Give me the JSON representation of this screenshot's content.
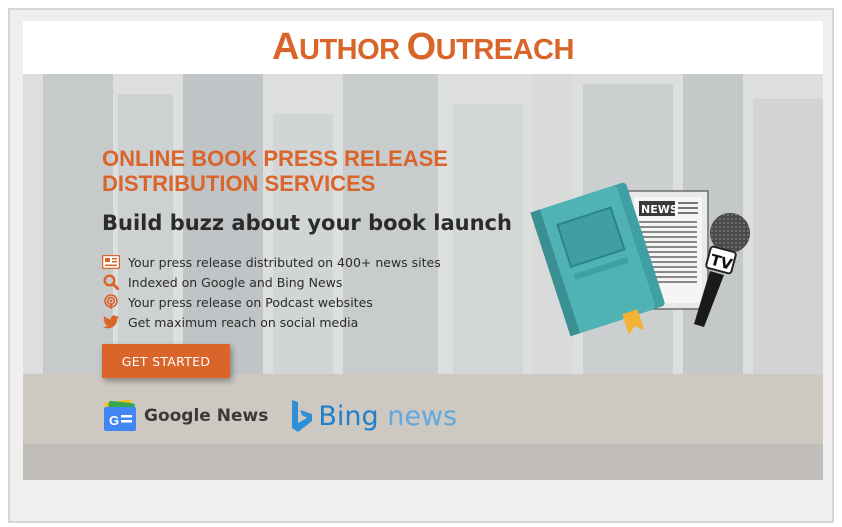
{
  "header": {
    "logo_first_initial": "A",
    "logo_first_rest": "UTHOR",
    "logo_second_initial": "O",
    "logo_second_rest": "UTREACH"
  },
  "hero": {
    "title_line1": "ONLINE BOOK PRESS RELEASE",
    "title_line2": "DISTRIBUTION SERVICES",
    "subtitle": "Build buzz about your book launch",
    "features": [
      {
        "icon": "news-icon",
        "label": "Your press release distributed on 400+ news sites"
      },
      {
        "icon": "search-icon",
        "label": "Indexed on Google and Bing News"
      },
      {
        "icon": "podcast-icon",
        "label": "Your press release on Podcast websites"
      },
      {
        "icon": "twitter-icon",
        "label": "Get maximum reach on social media"
      }
    ],
    "cta_label": "GET STARTED",
    "partners": {
      "google_news": "Google News",
      "bing_word": "Bing",
      "bing_news_word": "news"
    },
    "illustration": {
      "newspaper_label": "NEWS",
      "microphone_label": "TV"
    }
  },
  "colors": {
    "brand_orange": "#d9652b",
    "book_teal": "#4fb3b5",
    "bing_blue": "#2f8fd6"
  }
}
